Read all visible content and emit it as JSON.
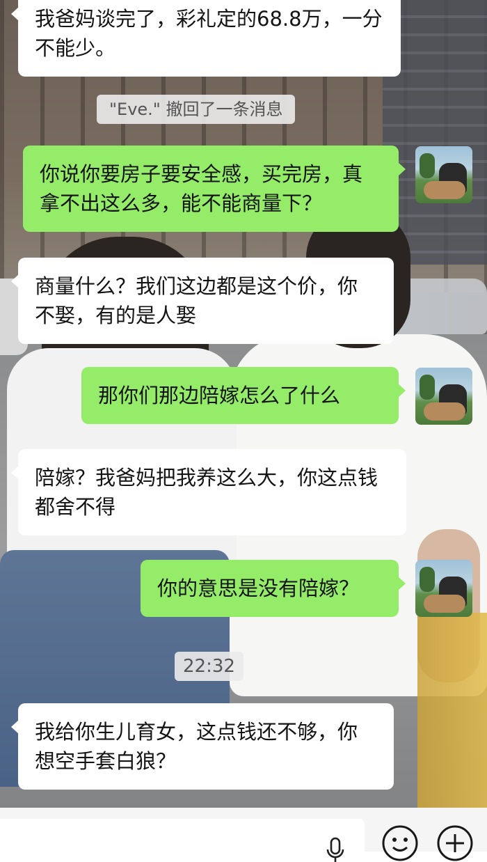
{
  "messages": [
    {
      "side": "left",
      "text": "我爸妈谈完了，彩礼定的68.8万，一分不能少。"
    },
    {
      "side": "system",
      "text": "\"Eve.\" 撤回了一条消息"
    },
    {
      "side": "right",
      "text": "你说你要房子要安全感，买完房，真拿不出这么多，能不能商量下？"
    },
    {
      "side": "left",
      "text": "商量什么？我们这边都是这个价，你不娶，有的是人娶"
    },
    {
      "side": "right",
      "text": "那你们那边陪嫁怎么了什么"
    },
    {
      "side": "left",
      "text": "陪嫁？我爸妈把我养这么大，你这点钱都舍不得"
    },
    {
      "side": "right",
      "text": "你的意思是没有陪嫁？"
    },
    {
      "side": "time",
      "text": "22:32"
    },
    {
      "side": "left",
      "text": "我给你生儿育女，这点钱还不够，你想空手套白狼？"
    }
  ],
  "input_bar": {
    "icons": [
      "microphone-icon",
      "emoji-icon",
      "plus-icon"
    ]
  },
  "colors": {
    "bubble_self": "#95ec69",
    "bubble_other": "#ffffff"
  }
}
